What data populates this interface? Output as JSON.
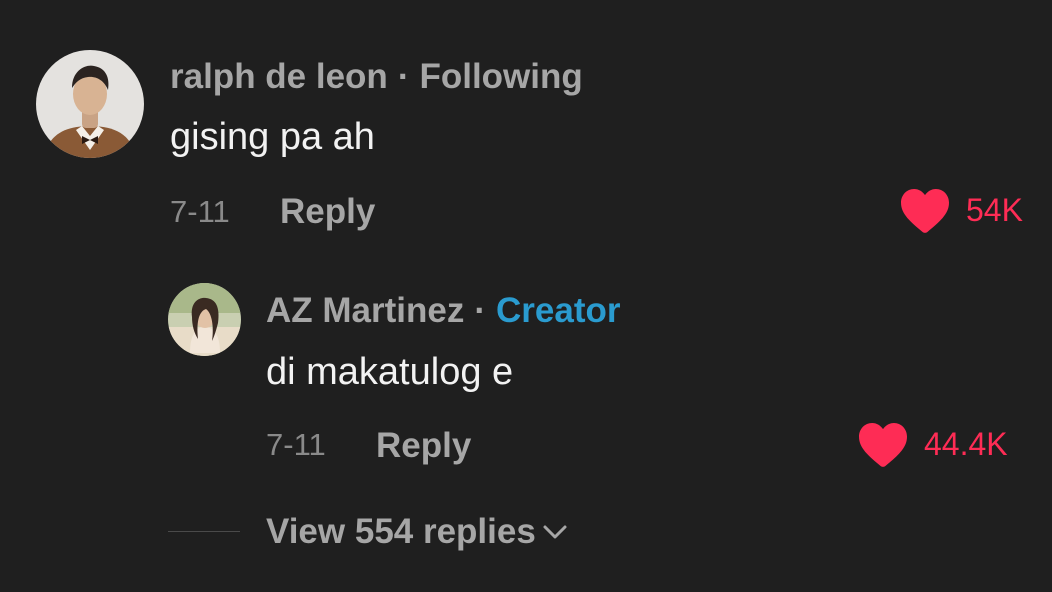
{
  "comment": {
    "author": "ralph de leon",
    "separator": "·",
    "relation": "Following",
    "text": "gising pa ah",
    "date": "7-11",
    "reply_label": "Reply",
    "likes": "54K",
    "avatar_icon": "user-avatar-photo"
  },
  "reply": {
    "author": "AZ Martinez",
    "separator": "·",
    "badge": "Creator",
    "text": "di makatulog e",
    "date": "7-11",
    "reply_label": "Reply",
    "likes": "44.4K",
    "avatar_icon": "user-avatar-photo"
  },
  "view_replies": {
    "label": "View 554 replies",
    "icon": "chevron-down-icon"
  },
  "colors": {
    "background": "#1f1f1f",
    "like": "#fe2c55",
    "creator": "#2a9bcf",
    "primary_text": "#f2f2f2",
    "secondary_text": "#a6a6a6"
  }
}
